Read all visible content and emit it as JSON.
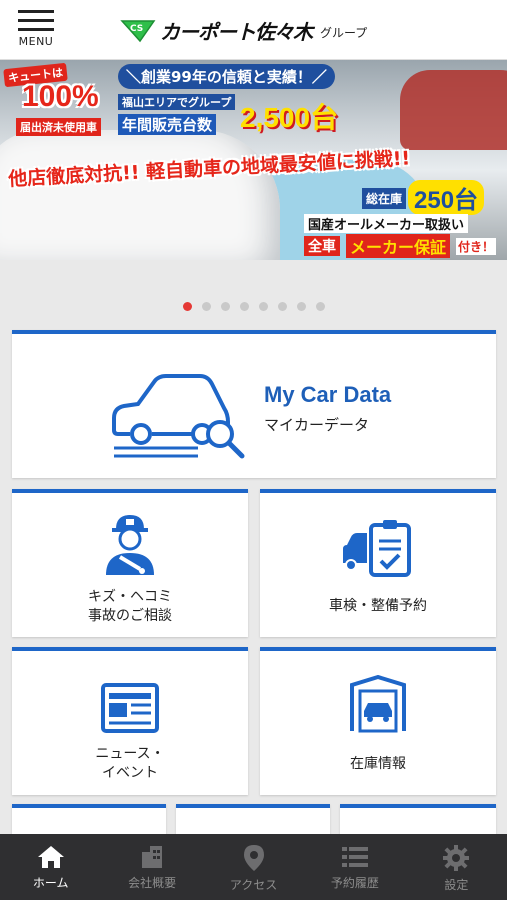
{
  "header": {
    "menu_label": "MENU",
    "logo_badge": "CS",
    "brand_name": "カーポート佐々木",
    "brand_group": "グループ"
  },
  "banner": {
    "cute_label": "キュートは",
    "percent": "100%",
    "unused_label": "届出済未使用車",
    "headline": "＼創業99年の信頼と実績！／",
    "area_label": "福山エリアでグループ",
    "annual_label": "年間販売台数",
    "annual_count": "2,500台",
    "challenge": "他店徹底対抗!! 軽自動車の地域最安値に挑戦!!",
    "stock_label": "総在庫",
    "stock_count": "250台",
    "all_makers": "国産オールメーカー取扱い",
    "warranty_prefix": "全車",
    "warranty": "メーカー保証",
    "warranty_suffix": "付き！"
  },
  "carousel": {
    "count": 8,
    "active_index": 0
  },
  "tiles": {
    "mycar_title": "My Car Data",
    "mycar_sub": "マイカーデータ",
    "repair_line1": "キズ・ヘコミ",
    "repair_line2": "事故のご相談",
    "inspection": "車検・整備予約",
    "news_line1": "ニュース・",
    "news_line2": "イベント",
    "stock": "在庫情報"
  },
  "tabbar": [
    {
      "label": "ホーム",
      "icon": "home-icon",
      "active": true
    },
    {
      "label": "会社概要",
      "icon": "building-icon",
      "active": false
    },
    {
      "label": "アクセス",
      "icon": "map-pin-icon",
      "active": false
    },
    {
      "label": "予約履歴",
      "icon": "list-icon",
      "active": false
    },
    {
      "label": "設定",
      "icon": "gear-icon",
      "active": false
    }
  ],
  "colors": {
    "accent": "#1e66c8",
    "active_dot": "#e53935",
    "tabbar": "#2f2f31"
  }
}
